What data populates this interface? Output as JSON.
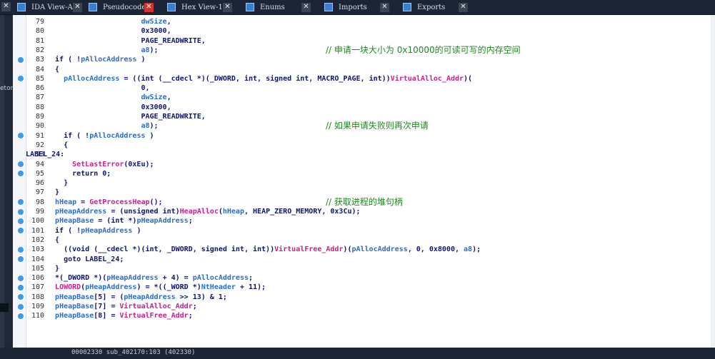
{
  "tabs": [
    {
      "label": "IDA View-A",
      "active": false
    },
    {
      "label": "Pseudocode-A",
      "active": true
    },
    {
      "label": "Hex View-1",
      "active": false
    },
    {
      "label": "Enums",
      "active": false
    },
    {
      "label": "Imports",
      "active": false
    },
    {
      "label": "Exports",
      "active": false
    }
  ],
  "left_panel": {
    "label": "etor"
  },
  "code_lines": [
    {
      "n": "79",
      "text": "                      dwSize,",
      "dot": false
    },
    {
      "n": "80",
      "text": "                      0x3000,",
      "dot": false
    },
    {
      "n": "81",
      "text": "                      PAGE_READWRITE,",
      "dot": false
    },
    {
      "n": "82",
      "text": "                      a8);",
      "dot": false,
      "comment": "// 申请一块大小为 0x10000的可读可写的内存空间"
    },
    {
      "n": "83",
      "text": "  if ( !pAllocAddress )",
      "dot": true
    },
    {
      "n": "84",
      "text": "  {",
      "dot": false
    },
    {
      "n": "85",
      "text": "    pAllocAddress = ((int (__cdecl *)(_DWORD, int, signed int, MACRO_PAGE, int))VirtualAlloc_Addr)(",
      "dot": true
    },
    {
      "n": "86",
      "text": "                      0,",
      "dot": false
    },
    {
      "n": "87",
      "text": "                      dwSize,",
      "dot": false
    },
    {
      "n": "88",
      "text": "                      0x3000,",
      "dot": false
    },
    {
      "n": "89",
      "text": "                      PAGE_READWRITE,",
      "dot": false
    },
    {
      "n": "90",
      "text": "                      a8);",
      "dot": false,
      "comment": "// 如果申请失败则再次申请"
    },
    {
      "n": "91",
      "text": "    if ( !pAllocAddress )",
      "dot": true
    },
    {
      "n": "92",
      "text": "    {",
      "dot": false
    },
    {
      "n": "93",
      "text": "LABEL_24:",
      "dot": false,
      "label": true
    },
    {
      "n": "94",
      "text": "      SetLastError(0xEu);",
      "dot": true
    },
    {
      "n": "95",
      "text": "      return 0;",
      "dot": true
    },
    {
      "n": "96",
      "text": "    }",
      "dot": false
    },
    {
      "n": "97",
      "text": "  }",
      "dot": false
    },
    {
      "n": "98",
      "text": "  hHeap = GetProcessHeap();",
      "dot": true,
      "comment": "// 获取进程的堆句柄"
    },
    {
      "n": "99",
      "text": "  pHeapAddress = (unsigned int)HeapAlloc(hHeap, HEAP_ZERO_MEMORY, 0x3Cu);",
      "dot": true
    },
    {
      "n": "100",
      "text": "  pHeapBase = (int *)pHeapAddress;",
      "dot": true
    },
    {
      "n": "101",
      "text": "  if ( !pHeapAddress )",
      "dot": true
    },
    {
      "n": "102",
      "text": "  {",
      "dot": false
    },
    {
      "n": "103",
      "text": "    ((void (__cdecl *)(int, _DWORD, signed int, int))VirtualFree_Addr)(pAllocAddress, 0, 0x8000, a8);",
      "dot": true
    },
    {
      "n": "104",
      "text": "    goto LABEL_24;",
      "dot": true
    },
    {
      "n": "105",
      "text": "  }",
      "dot": false
    },
    {
      "n": "106",
      "text": "  *(_DWORD *)(pHeapAddress + 4) = pAllocAddress;",
      "dot": true
    },
    {
      "n": "107",
      "text": "  LOWORD(pHeapAddress) = *((_WORD *)NtHeader + 11);",
      "dot": true
    },
    {
      "n": "108",
      "text": "  pHeapBase[5] = (pHeapAddress >> 13) & 1;",
      "dot": true
    },
    {
      "n": "109",
      "text": "  pHeapBase[7] = VirtualAlloc_Addr;",
      "dot": true
    },
    {
      "n": "110",
      "text": "  pHeapBase[8] = VirtualFree_Addr;",
      "dot": true
    }
  ],
  "status": {
    "text": "00002330  sub_402170:103 (402330)"
  },
  "colors": {
    "bg": "#ffffff",
    "code": "#0e1570",
    "identifier": "#2c6dc8",
    "function": "#c8208a",
    "comment": "#1c8a1c",
    "breakpoint": "#3c9be8"
  }
}
